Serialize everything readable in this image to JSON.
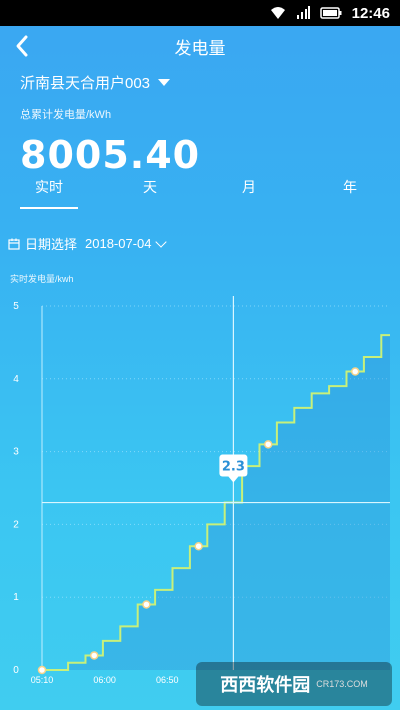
{
  "status_bar": {
    "time": "12:46"
  },
  "header": {
    "title": "发电量"
  },
  "account": {
    "name": "沂南县天合用户003"
  },
  "total": {
    "label": "总累计发电量/kWh",
    "value": "8005.40"
  },
  "tabs": [
    {
      "label": "实时",
      "active": true
    },
    {
      "label": "天",
      "active": false
    },
    {
      "label": "月",
      "active": false
    },
    {
      "label": "年",
      "active": false
    }
  ],
  "date": {
    "label": "日期选择",
    "value": "2018-07-04"
  },
  "watermark": {
    "text": "西西软件园",
    "url": "CR173.COM"
  },
  "colors": {
    "line": "#c8f07a",
    "grid": "#9fe4ff",
    "background": "#3aa6f2"
  },
  "chart_data": {
    "type": "line",
    "ylabel": "实时发电量/kwh",
    "ylim": [
      0,
      5
    ],
    "yticks": [
      "0",
      "1",
      "2",
      "3",
      "4",
      "5"
    ],
    "xticks": [
      "05:10",
      "06:00",
      "06:50"
    ],
    "x": [
      0,
      1,
      2,
      3,
      4,
      5,
      6,
      7,
      8,
      9,
      10,
      11,
      12,
      13,
      14,
      15,
      16,
      17,
      18,
      19,
      20
    ],
    "values": [
      0.0,
      0.0,
      0.1,
      0.2,
      0.4,
      0.6,
      0.9,
      1.1,
      1.4,
      1.7,
      2.0,
      2.3,
      2.8,
      3.1,
      3.4,
      3.6,
      3.8,
      3.9,
      4.1,
      4.3,
      4.6
    ],
    "markers": [
      0,
      3,
      6,
      9,
      13,
      18
    ],
    "highlight": {
      "index": 11,
      "label": "2.3"
    }
  }
}
